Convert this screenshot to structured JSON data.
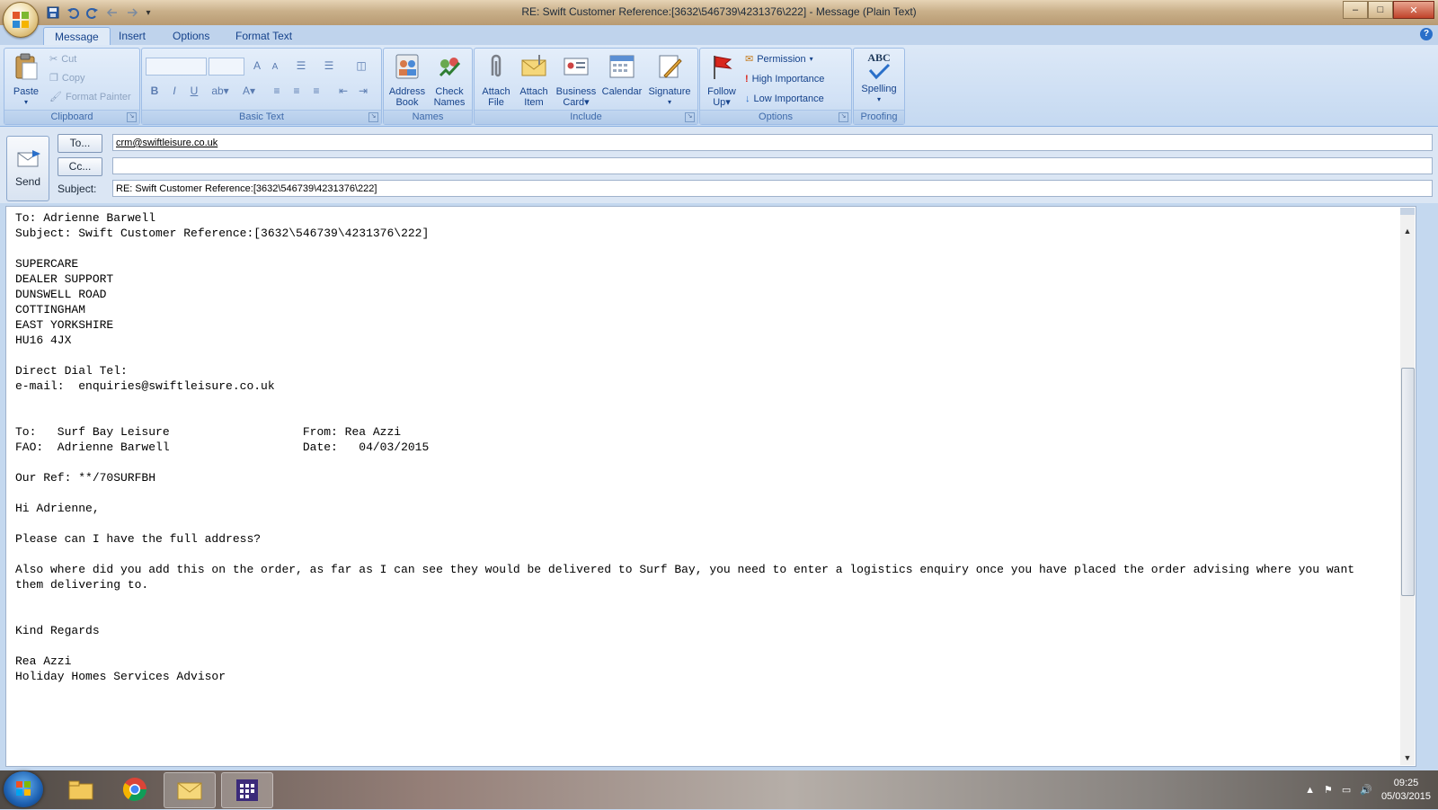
{
  "window": {
    "title": "RE: Swift Customer Reference:[3632\\546739\\4231376\\222] - Message (Plain Text)",
    "controls": {
      "minimize": "–",
      "maximize": "□",
      "close": "✕"
    }
  },
  "tabs": [
    {
      "label": "Message",
      "active": true
    },
    {
      "label": "Insert"
    },
    {
      "label": "Options"
    },
    {
      "label": "Format Text"
    }
  ],
  "ribbon": {
    "clipboard": {
      "group_label": "Clipboard",
      "paste": "Paste",
      "cut": "Cut",
      "copy": "Copy",
      "format_painter": "Format Painter"
    },
    "basic_text": {
      "group_label": "Basic Text",
      "bold": "B",
      "italic": "I",
      "underline": "U",
      "font_color": "A",
      "grow": "A",
      "shrink": "A"
    },
    "names": {
      "group_label": "Names",
      "address_book": [
        "Address",
        "Book"
      ],
      "check_names": [
        "Check",
        "Names"
      ]
    },
    "include": {
      "group_label": "Include",
      "attach_file": [
        "Attach",
        "File"
      ],
      "attach_item": [
        "Attach",
        "Item"
      ],
      "business_card": [
        "Business",
        "Card"
      ],
      "calendar": "Calendar",
      "signature": "Signature"
    },
    "options": {
      "group_label": "Options",
      "follow_up": [
        "Follow",
        "Up"
      ],
      "permission": "Permission",
      "high_importance": "High Importance",
      "low_importance": "Low Importance"
    },
    "proofing": {
      "group_label": "Proofing",
      "spelling": "Spelling",
      "abc": "ABC"
    }
  },
  "header": {
    "send": "Send",
    "to_button": "To...",
    "cc_button": "Cc...",
    "subject_label": "Subject:",
    "to_value": "crm@swiftleisure.co.uk",
    "cc_value": "",
    "subject_value": "RE: Swift Customer Reference:[3632\\546739\\4231376\\222]"
  },
  "body": {
    "text": "To: Adrienne Barwell\nSubject: Swift Customer Reference:[3632\\546739\\4231376\\222]\n\nSUPERCARE\nDEALER SUPPORT\nDUNSWELL ROAD\nCOTTINGHAM\nEAST YORKSHIRE\nHU16 4JX\n\nDirect Dial Tel:\ne-mail:  enquiries@swiftleisure.co.uk\n\n\nTo:   Surf Bay Leisure                   From: Rea Azzi\nFAO:  Adrienne Barwell                   Date:   04/03/2015\n\nOur Ref: **/70SURFBH\n\nHi Adrienne,\n\nPlease can I have the full address?\n\nAlso where did you add this on the order, as far as I can see they would be delivered to Surf Bay, you need to enter a logistics enquiry once you have placed the order advising where you want\nthem delivering to.\n\n\nKind Regards\n\nRea Azzi\nHoliday Homes Services Advisor"
  },
  "taskbar": {
    "time": "09:25",
    "date": "05/03/2015",
    "items": [
      "explorer-icon",
      "chrome-icon",
      "outlook-icon",
      "app-icon"
    ]
  },
  "colors": {
    "ribbon_text": "#15428b",
    "tab_bg": "#bfd3ec",
    "accent_blue": "#2a6fc9"
  }
}
